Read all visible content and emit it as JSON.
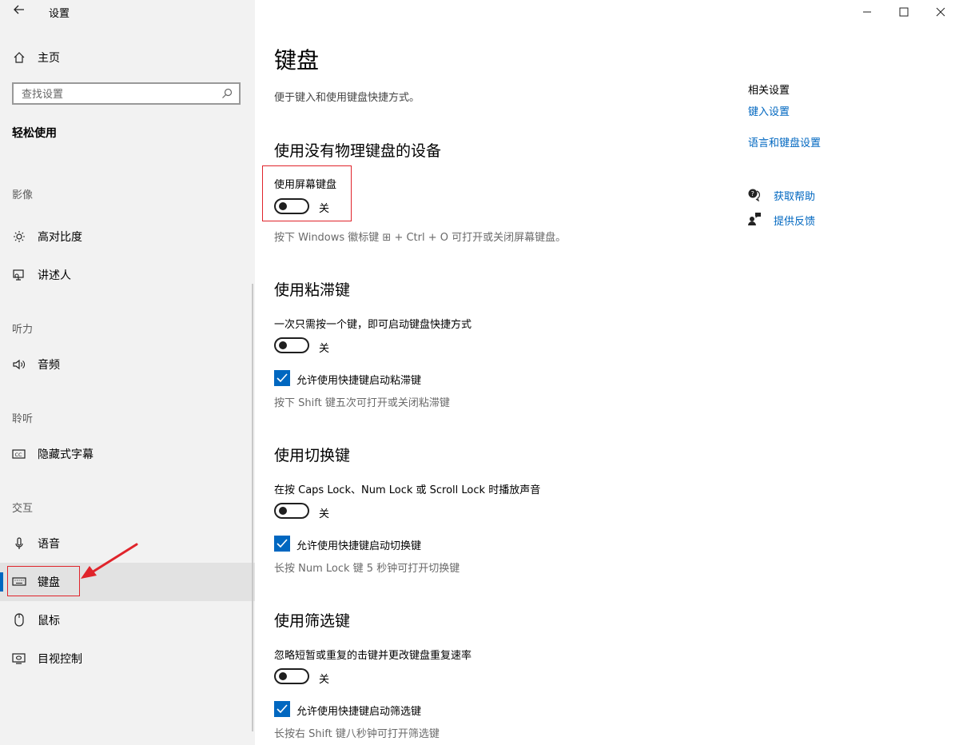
{
  "window": {
    "title": "设置"
  },
  "sidebar": {
    "home_label": "主页",
    "search_placeholder": "查找设置",
    "category": "轻松使用",
    "sections": {
      "vision": "影像",
      "hearing": "听力",
      "listening": "聆听",
      "interaction": "交互"
    },
    "items": {
      "high_contrast": "高对比度",
      "narrator": "讲述人",
      "audio": "音频",
      "captions": "隐藏式字幕",
      "speech": "语音",
      "keyboard": "键盘",
      "mouse": "鼠标",
      "eye_control": "目视控制"
    },
    "selected_item": "键盘"
  },
  "main": {
    "title": "键盘",
    "description": "便于键入和使用键盘快捷方式。",
    "osk": {
      "heading": "使用没有物理键盘的设备",
      "label": "使用屏幕键盘",
      "state": "关",
      "hint": "按下 Windows 徽标键 ⊞ + Ctrl + O 可打开或关闭屏幕键盘。"
    },
    "sticky": {
      "heading": "使用粘滞键",
      "label": "一次只需按一个键，即可启动键盘快捷方式",
      "state": "关",
      "checkbox_label": "允许使用快捷键启动粘滞键",
      "hint": "按下 Shift 键五次可打开或关闭粘滞键"
    },
    "toggle_keys": {
      "heading": "使用切换键",
      "label": "在按 Caps Lock、Num Lock 或 Scroll Lock 时播放声音",
      "state": "关",
      "checkbox_label": "允许使用快捷键启动切换键",
      "hint": "长按 Num Lock 键 5 秒钟可打开切换键"
    },
    "filter": {
      "heading": "使用筛选键",
      "label": "忽略短暂或重复的击键并更改键盘重复速率",
      "state": "关",
      "checkbox_label": "允许使用快捷键启动筛选键",
      "hint": "长按右 Shift 键八秒钟可打开筛选键"
    }
  },
  "related": {
    "title": "相关设置",
    "links": {
      "typing": "键入设置",
      "language": "语言和键盘设置"
    },
    "help": "获取帮助",
    "feedback": "提供反馈"
  },
  "colors": {
    "accent": "#0067c0",
    "annotation": "#e0242b",
    "sidebar_bg": "#f2f2f2"
  }
}
